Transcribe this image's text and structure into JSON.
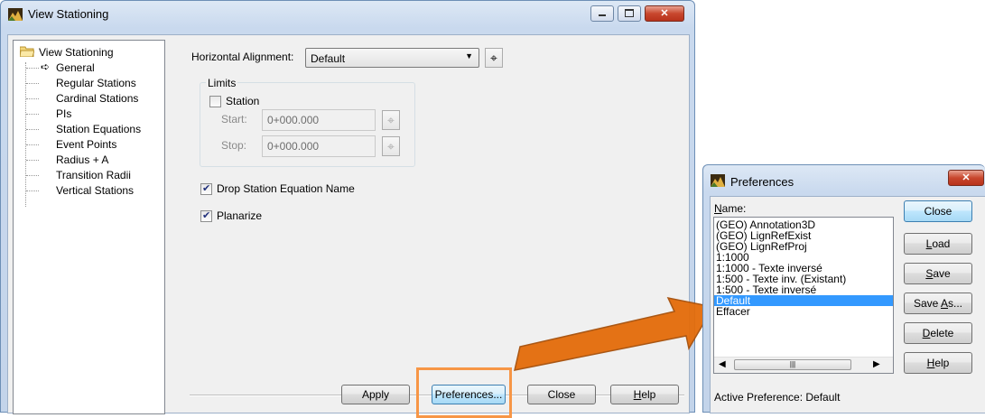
{
  "main_window": {
    "title": "View Stationing",
    "tree": {
      "root": "View Stationing",
      "items": [
        "General",
        "Regular Stations",
        "Cardinal Stations",
        "PIs",
        "Station Equations",
        "Event Points",
        "Radius + A",
        "Transition Radii",
        "Vertical Stations"
      ]
    },
    "horizontal_alignment": {
      "label": "Horizontal Alignment:",
      "value": "Default"
    },
    "limits": {
      "group_label": "Limits",
      "station_label": "Station",
      "start_label": "Start:",
      "start_value": "0+000.000",
      "stop_label": "Stop:",
      "stop_value": "0+000.000"
    },
    "drop_station_label": "Drop Station Equation Name",
    "planarize_label": "Planarize",
    "buttons": {
      "apply": "Apply",
      "preferences": "Preferences...",
      "close": "Close",
      "help_prefix": "",
      "help_mnemonic": "H",
      "help_rest": "elp"
    }
  },
  "preferences_window": {
    "title": "Preferences",
    "name_label_mnemonic": "N",
    "name_label_rest": "ame:",
    "items": [
      "(GEO) Annotation3D",
      "(GEO) LignRefExist",
      "(GEO) LignRefProj",
      "1:1000",
      "1:1000 - Texte inversé",
      "1:500 - Texte inv. (Existant)",
      "1:500 - Texte inversé",
      "Default",
      "Effacer"
    ],
    "selected_item": "Default",
    "buttons": {
      "close": "Close",
      "load_mnemonic": "L",
      "load_rest": "oad",
      "save_mnemonic": "S",
      "save_rest": "ave",
      "save_as_prefix": "Save ",
      "save_as_mnemonic": "A",
      "save_as_rest": "s...",
      "delete_mnemonic": "D",
      "delete_rest": "elete",
      "help_mnemonic": "H",
      "help_rest": "elp"
    },
    "active_preference": "Active Preference: Default"
  },
  "colors": {
    "highlight_box": "#f79646",
    "arrow": "#e46c0a",
    "selection": "#3399ff"
  }
}
